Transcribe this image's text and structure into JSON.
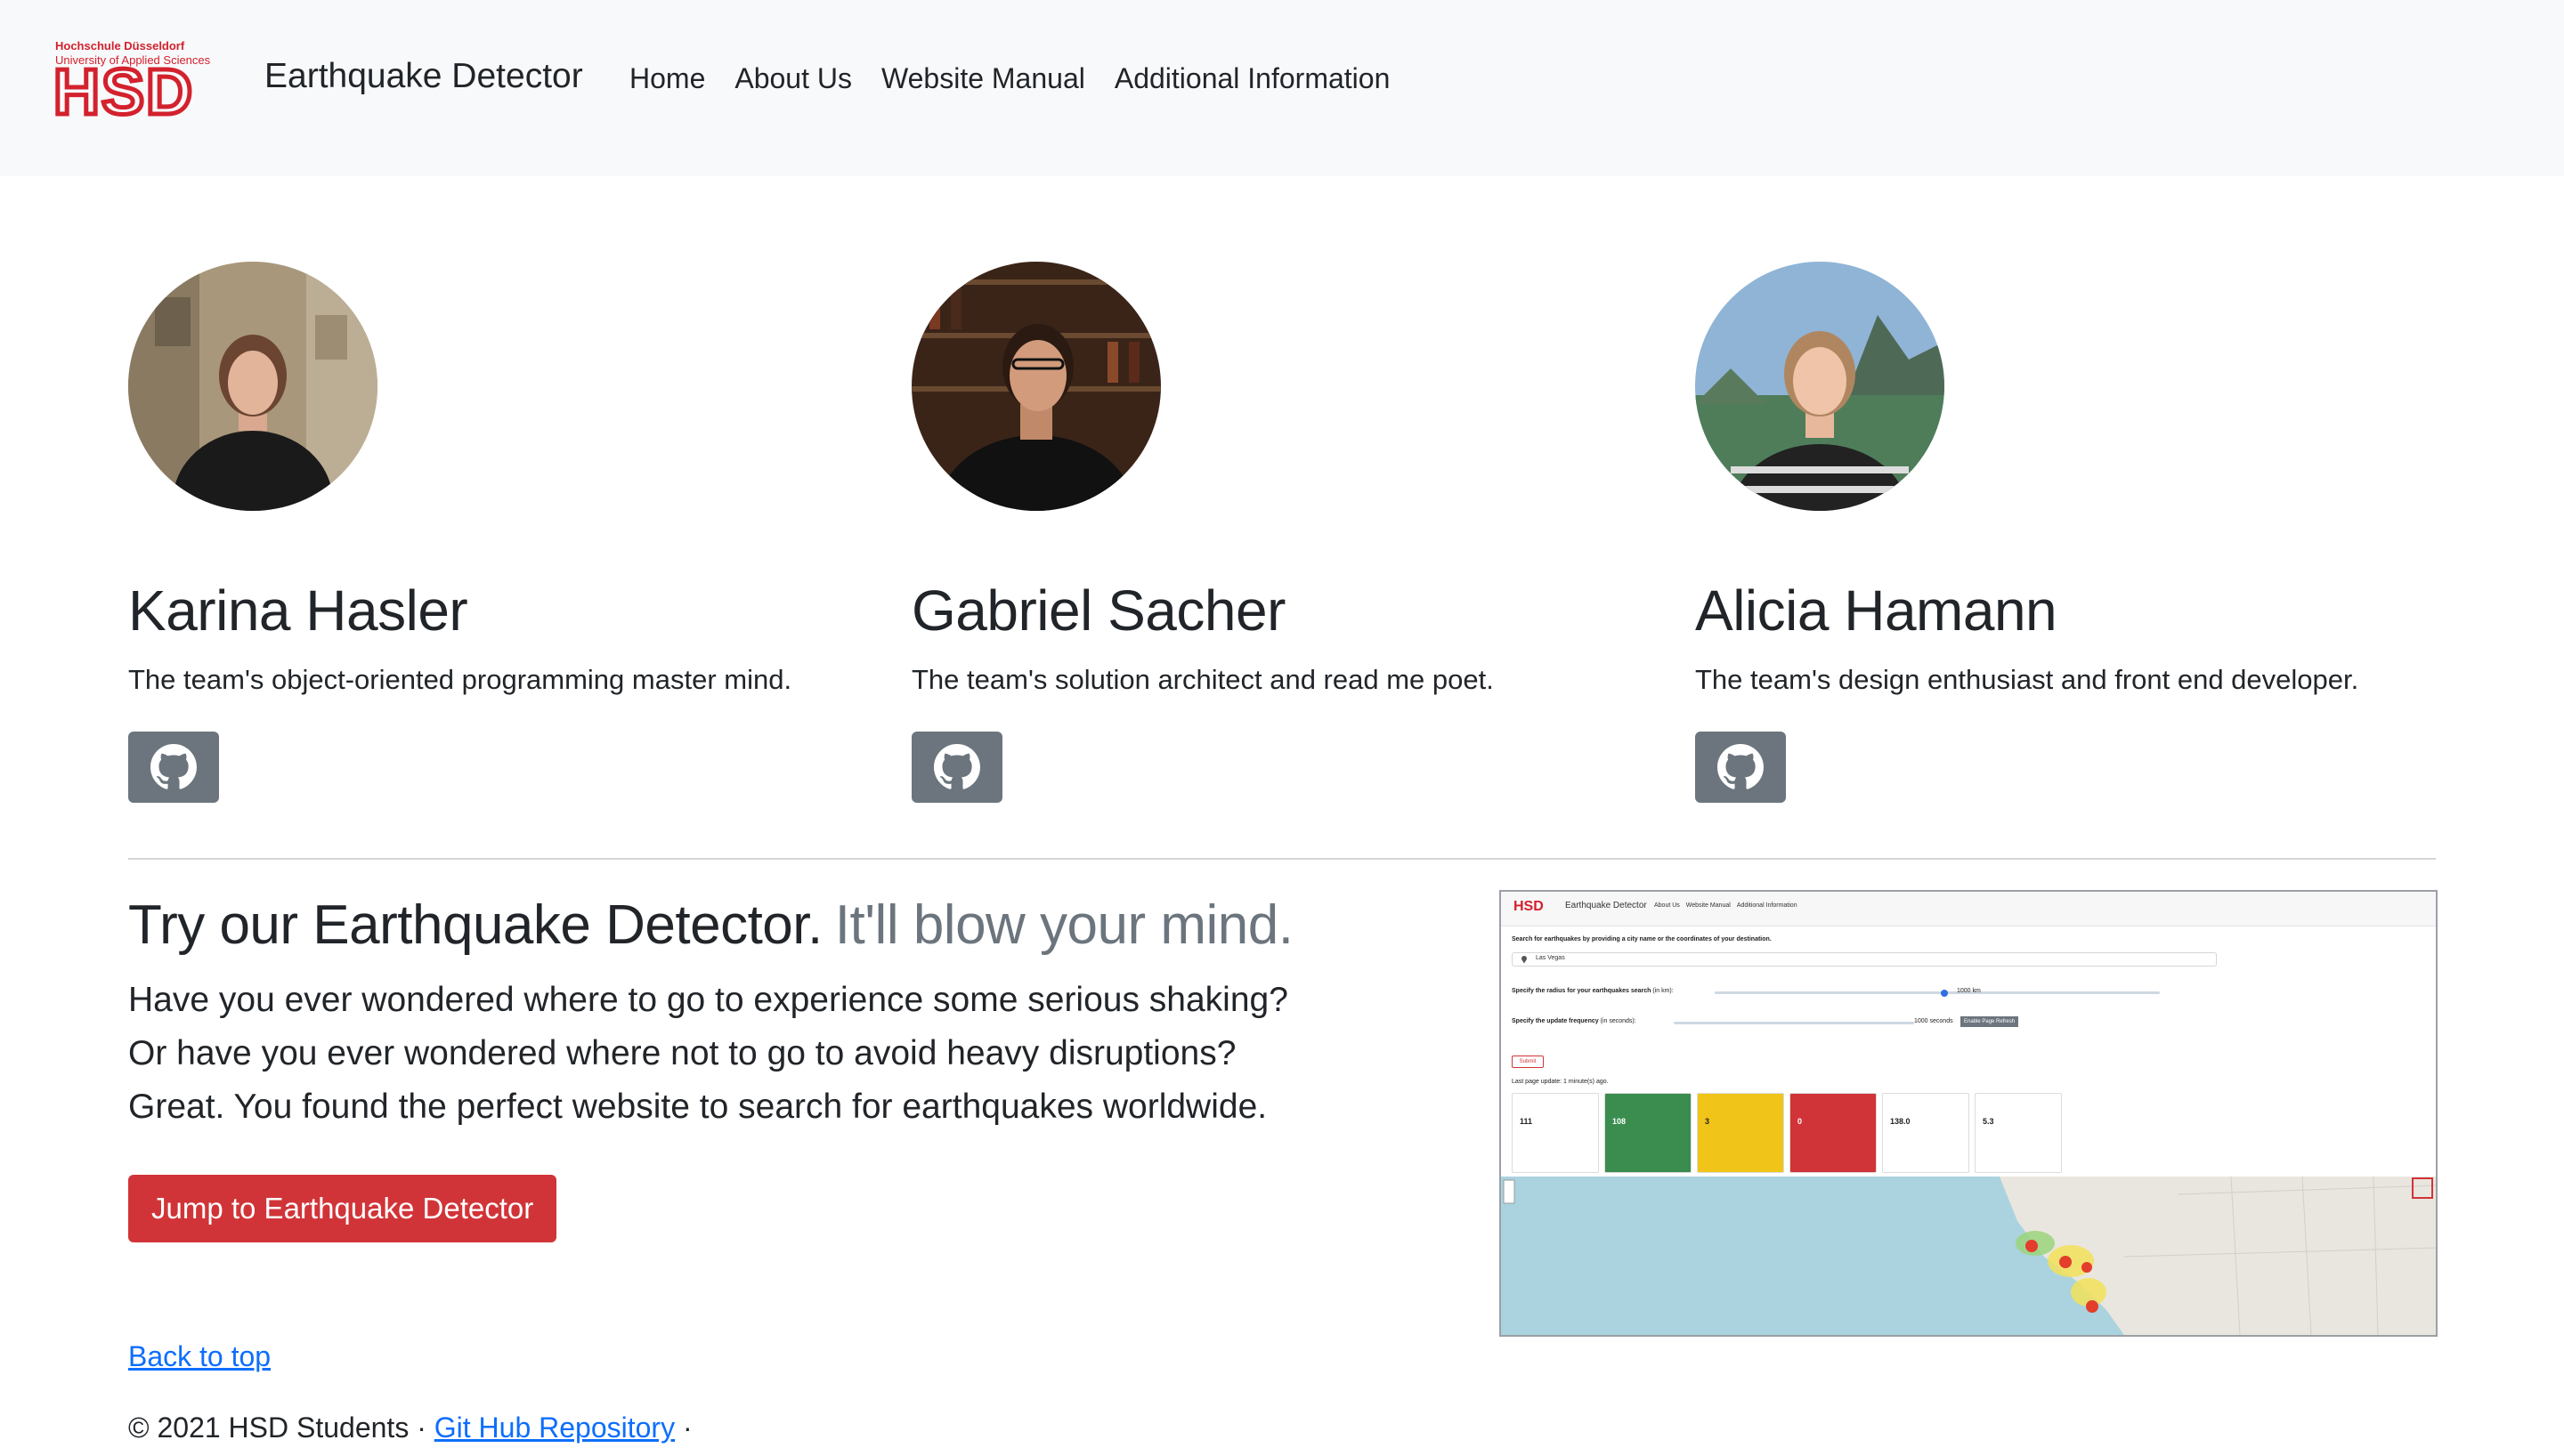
{
  "logo": {
    "line1": "Hochschule Düsseldorf",
    "line2": "University of Applied Sciences",
    "mark": "HSD",
    "color": "#d3212d"
  },
  "nav": {
    "brand": "Earthquake Detector",
    "links": [
      "Home",
      "About Us",
      "Website Manual",
      "Additional Information"
    ]
  },
  "team": [
    {
      "name": "Karina Hasler",
      "role": "The team's object-oriented programming master mind.",
      "icon": "github-icon"
    },
    {
      "name": "Gabriel Sacher",
      "role": "The team's solution architect and read me poet.",
      "icon": "github-icon"
    },
    {
      "name": "Alicia Hamann",
      "role": "The team's design enthusiast and front end developer.",
      "icon": "github-icon"
    }
  ],
  "feature": {
    "heading": "Try our Earthquake Detector.",
    "heading_muted": "It'll blow your mind.",
    "lines": [
      "Have you ever wondered where to go to experience some serious shaking?",
      "Or have you ever wondered where not to go to avoid heavy disruptions?",
      "Great. You found the perfect website to search for earthquakes worldwide."
    ],
    "cta": "Jump to Earthquake Detector"
  },
  "preview": {
    "logo": "HSD",
    "brand": "Earthquake Detector",
    "links": [
      "About Us",
      "Website Manual",
      "Additional Information"
    ],
    "search_label": "Search for earthquakes by providing a city name or the coordinates of your destination.",
    "search_value": "Las Vegas",
    "radius_label": "Specify the radius for your earthquakes search",
    "radius_unit": "(in km):",
    "radius_value": "1000 km",
    "freq_label": "Specify the update frequency",
    "freq_unit": "(in seconds):",
    "freq_value": "1000 seconds",
    "refresh": "Enable Page Refresh",
    "submit": "Submit",
    "last_update": "Last page update: 1 minute(s) ago.",
    "cards": [
      {
        "value": "111",
        "bg": "#ffffff",
        "fg": "#222222"
      },
      {
        "value": "108",
        "bg": "#3a8d4e",
        "fg": "#ffffff"
      },
      {
        "value": "3",
        "bg": "#f0c419",
        "fg": "#222222"
      },
      {
        "value": "0",
        "bg": "#d13438",
        "fg": "#ffffff"
      },
      {
        "value": "138.0",
        "bg": "#ffffff",
        "fg": "#222222"
      },
      {
        "value": "5.3",
        "bg": "#ffffff",
        "fg": "#222222"
      }
    ]
  },
  "footer": {
    "back_to_top": "Back to top",
    "copyright": "© 2021 HSD Students ·",
    "repo_link": "Git Hub Repository",
    "trailing": "·"
  }
}
